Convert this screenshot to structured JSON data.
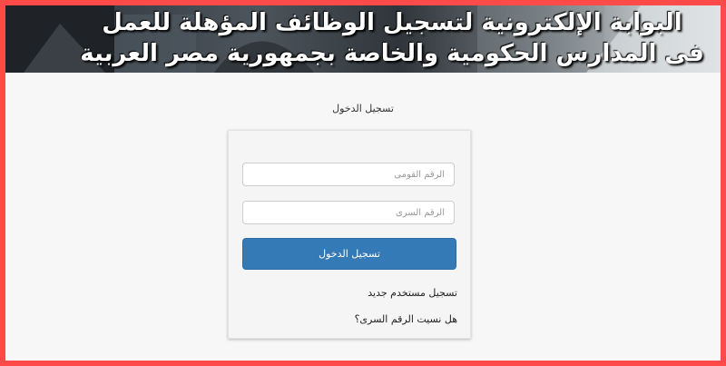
{
  "banner": {
    "line1": "البوابة الإلكترونية لتسجيل الوظائف المؤهلة للعمل",
    "line2": "فى المدارس الحكومية والخاصة بجمهورية مصر العربية"
  },
  "login": {
    "heading": "تسجيل الدخول",
    "national_id_placeholder": "الرقم القومى",
    "password_placeholder": "الرقم السرى",
    "submit_label": "تسجيل الدخول",
    "register_link": "تسجيل مستخدم جديد",
    "forgot_link": "هل نسيت الرقم السرى؟"
  },
  "colors": {
    "page_border": "#ff4a4a",
    "primary_button": "#337ab7"
  }
}
